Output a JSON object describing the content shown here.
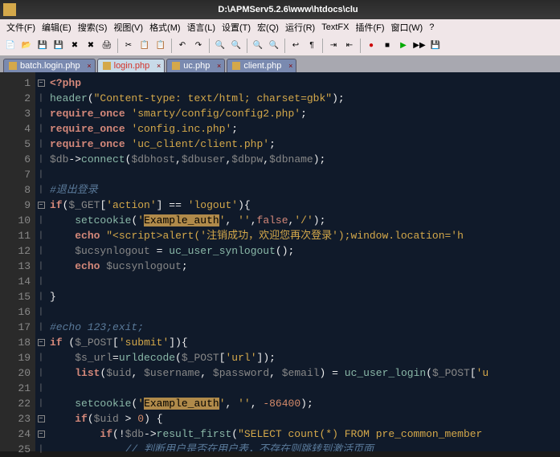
{
  "titlebar": {
    "title": "D:\\APMServ5.2.6\\www\\htdocs\\clu"
  },
  "menu": {
    "file": "文件(F)",
    "edit": "编辑(E)",
    "search": "搜索(S)",
    "view": "视图(V)",
    "format": "格式(M)",
    "lang": "语言(L)",
    "settings": "设置(T)",
    "macro": "宏(Q)",
    "run": "运行(R)",
    "textfx": "TextFX",
    "plugins": "插件(F)",
    "window": "窗口(W)",
    "help": "?"
  },
  "tabs": [
    {
      "label": "batch.login.php",
      "active": false
    },
    {
      "label": "login.php",
      "active": true
    },
    {
      "label": "uc.php",
      "active": false
    },
    {
      "label": "client.php",
      "active": false
    }
  ],
  "lines": [
    "1",
    "2",
    "3",
    "4",
    "5",
    "6",
    "7",
    "8",
    "9",
    "10",
    "11",
    "12",
    "13",
    "14",
    "15",
    "16",
    "17",
    "18",
    "19",
    "20",
    "21",
    "22",
    "23",
    "24",
    "25"
  ],
  "code": {
    "l1_open": "<?php",
    "l2_func": "header",
    "l2_str": "\"Content-type: text/html; charset=gbk\"",
    "l3_kw": "require_once",
    "l3_str": "'smarty/config/config2.php'",
    "l4_kw": "require_once",
    "l4_str": "'config.inc.php'",
    "l5_kw": "require_once",
    "l5_str": "'uc_client/client.php'",
    "l6_db": "$db",
    "l6_m": "connect",
    "l6_a": "$dbhost",
    "l6_b": "$dbuser",
    "l6_c": "$dbpw",
    "l6_d": "$dbname",
    "l8_com": "#退出登录",
    "l9_if": "if",
    "l9_get": "$_GET",
    "l9_act": "'action'",
    "l9_eq": "==",
    "l9_lo": "'logout'",
    "l10_sc": "setcookie",
    "l10_s1": "'",
    "l10_hl": "Example_auth",
    "l10_s1b": "'",
    "l10_s2": "''",
    "l10_false": "false",
    "l10_s3": "'/'",
    "l11_echo": "echo",
    "l11_s": "\"<script>alert('注销成功，欢迎您再次登录');window.location='h",
    "l12_v": "$ucsynlogout",
    "l12_f": "uc_user_synlogout",
    "l13_echo": "echo",
    "l13_v": "$ucsynlogout",
    "l17_com": "#echo 123;exit;",
    "l18_if": "if",
    "l18_post": "$_POST",
    "l18_sub": "'submit'",
    "l19_v": "$s_url",
    "l19_f": "urldecode",
    "l19_post": "$_POST",
    "l19_url": "'url'",
    "l20_list": "list",
    "l20_uid": "$uid",
    "l20_un": "$username",
    "l20_pw": "$password",
    "l20_em": "$email",
    "l20_f": "uc_user_login",
    "l20_post": "$_POST",
    "l20_u": "'u",
    "l22_sc": "setcookie",
    "l22_s1": "'",
    "l22_hl": "Example_auth",
    "l22_s1b": "'",
    "l22_s2": "''",
    "l22_n": "-86400",
    "l23_if": "if",
    "l23_uid": "$uid",
    "l23_gt": ">",
    "l23_z": "0",
    "l24_if": "if",
    "l24_db": "$db",
    "l24_m": "result_first",
    "l24_s": "\"SELECT count(*) FROM pre_common_member",
    "l25_com": "// 判断用户是否在用户表，不存在则跳转到激活页面"
  }
}
